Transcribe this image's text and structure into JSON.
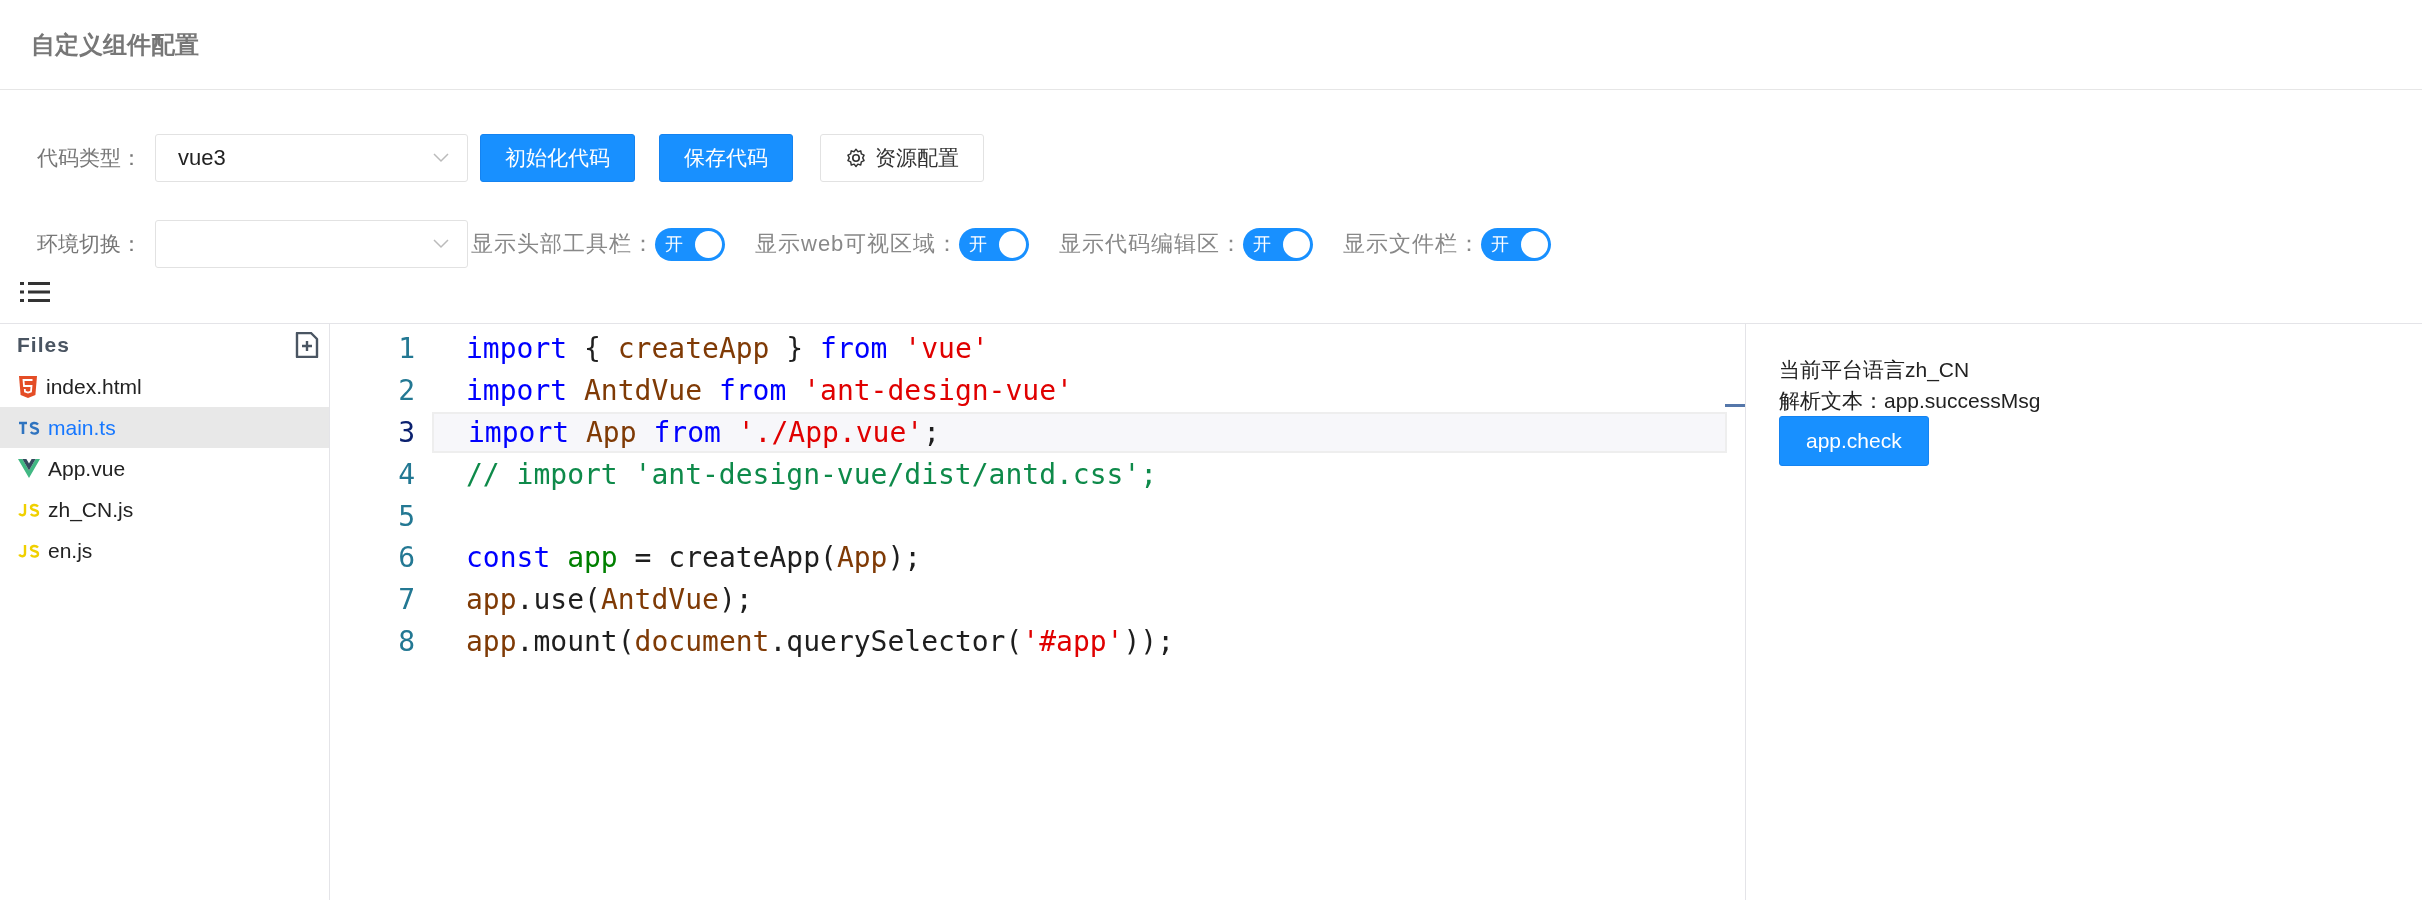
{
  "header": {
    "title": "自定义组件配置"
  },
  "toolbar": {
    "code_type": {
      "label": "代码类型：",
      "value": "vue3"
    },
    "buttons": [
      {
        "label": "初始化代码",
        "kind": "primary"
      },
      {
        "label": "保存代码",
        "kind": "primary"
      },
      {
        "label": "资源配置",
        "kind": "settings"
      }
    ],
    "environment": {
      "label": "环境切换："
    },
    "switches": [
      {
        "label": "显示头部工具栏：",
        "text": "开",
        "on": true
      },
      {
        "label": "显示web可视区域：",
        "text": "开",
        "on": true
      },
      {
        "label": "显示代码编辑区：",
        "text": "开",
        "on": true
      },
      {
        "label": "显示文件栏：",
        "text": "开",
        "on": true
      }
    ]
  },
  "files": {
    "title": "Files",
    "items": [
      {
        "name": "index.html",
        "kind": "html",
        "selected": false
      },
      {
        "name": "main.ts",
        "kind": "ts",
        "selected": true
      },
      {
        "name": "App.vue",
        "kind": "vue",
        "selected": false
      },
      {
        "name": "zh_CN.js",
        "kind": "js",
        "selected": false
      },
      {
        "name": "en.js",
        "kind": "js",
        "selected": false
      }
    ]
  },
  "editor": {
    "lines": [
      {
        "number": "1",
        "active": false,
        "tokens": [
          {
            "t": "import",
            "kind": "keyword"
          },
          {
            "t": " { ",
            "kind": "plain"
          },
          {
            "t": "createApp",
            "kind": "ident"
          },
          {
            "t": " } ",
            "kind": "plain"
          },
          {
            "t": "from ",
            "kind": "keyword"
          },
          {
            "t": "'vue'",
            "kind": "string"
          }
        ]
      },
      {
        "number": "2",
        "active": false,
        "tokens": [
          {
            "t": "import ",
            "kind": "keyword"
          },
          {
            "t": "AntdVue ",
            "kind": "ident"
          },
          {
            "t": "from ",
            "kind": "keyword"
          },
          {
            "t": "'ant-design-vue'",
            "kind": "string"
          }
        ]
      },
      {
        "number": "3",
        "active": true,
        "tokens": [
          {
            "t": "import ",
            "kind": "keyword"
          },
          {
            "t": "App ",
            "kind": "ident"
          },
          {
            "t": "from ",
            "kind": "keyword"
          },
          {
            "t": "'./App.vue'",
            "kind": "string"
          },
          {
            "t": ";",
            "kind": "plain"
          }
        ]
      },
      {
        "number": "4",
        "active": false,
        "tokens": [
          {
            "t": "// import 'ant-design-vue/dist/antd.css';",
            "kind": "comment"
          }
        ]
      },
      {
        "number": "5",
        "active": false
      },
      {
        "number": "6",
        "active": false,
        "tokens": [
          {
            "t": "const ",
            "kind": "keyword"
          },
          {
            "t": "app",
            "kind": "local"
          },
          {
            "t": " = createApp(",
            "kind": "plain"
          },
          {
            "t": "App",
            "kind": "ident"
          },
          {
            "t": ");",
            "kind": "plain"
          }
        ]
      },
      {
        "number": "7",
        "active": false,
        "tokens": [
          {
            "t": "app",
            "kind": "ident"
          },
          {
            "t": ".use(",
            "kind": "plain"
          },
          {
            "t": "AntdVue",
            "kind": "ident"
          },
          {
            "t": ");",
            "kind": "plain"
          }
        ]
      },
      {
        "number": "8",
        "active": false,
        "tokens": [
          {
            "t": "app",
            "kind": "ident"
          },
          {
            "t": ".mount(",
            "kind": "plain"
          },
          {
            "t": "document",
            "kind": "ident"
          },
          {
            "t": ".querySelector(",
            "kind": "plain"
          },
          {
            "t": "'#app'",
            "kind": "string"
          },
          {
            "t": "));",
            "kind": "plain"
          }
        ]
      }
    ]
  },
  "preview": {
    "lines": [
      "当前平台语言zh_CN",
      "解析文本：app.successMsg"
    ],
    "button": "app.check"
  }
}
